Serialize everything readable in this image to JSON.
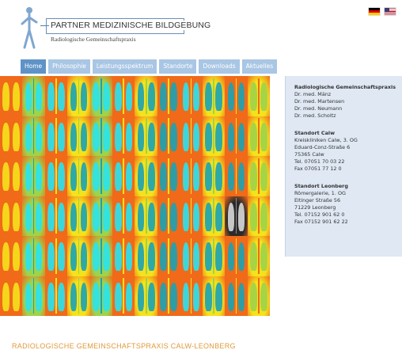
{
  "logo": {
    "name": "PARTNER MEDIZINISCHE BILDGEBUNG",
    "subtitle": "Radiologische Gemeinschaftspraxis",
    "icon": "person-figure-icon"
  },
  "flags": [
    {
      "name": "flag-de-icon",
      "language": "Deutsch"
    },
    {
      "name": "flag-us-icon",
      "language": "English"
    }
  ],
  "nav": {
    "tabs": [
      {
        "label": "Home",
        "active": true
      },
      {
        "label": "Philosophie",
        "active": false
      },
      {
        "label": "Leistungsspektrum",
        "active": false
      },
      {
        "label": "Standorte",
        "active": false
      },
      {
        "label": "Downloads",
        "active": false
      },
      {
        "label": "Aktuelles",
        "active": false
      }
    ],
    "colors": {
      "active": "#5f93c7",
      "inactive": "#a9c6e4"
    }
  },
  "hero": {
    "icon": "chest-xray-collage-image",
    "palette": {
      "warm": "#f06a1a",
      "yellow": "#f5e21c",
      "green": "#9fd34a",
      "teal": "#1aa3b5",
      "cyan": "#28e3f0",
      "gray": "#8a8a8a"
    }
  },
  "sidebar": {
    "practice": {
      "heading": "Radiologische Gemeinschaftspraxis",
      "doctors": [
        "Dr. med. Mänz",
        "Dr. med. Martensen",
        "Dr. med. Neumann",
        "Dr. med. Scholtz"
      ]
    },
    "calw": {
      "heading": "Standort Calw",
      "lines": [
        "Kreiskliniken Calw, 3. OG",
        "Eduard-Conz-Straße 6",
        "75365 Calw",
        "Tel. 07051 70 03 22",
        "Fax 07051 77 12 0"
      ]
    },
    "leonberg": {
      "heading": "Standort Leonberg",
      "lines": [
        "Römergalerie, 1. OG",
        "Eltinger Straße 56",
        "71229 Leonberg",
        "Tel. 07152 901 62 0",
        "Fax 07152 901 62 22"
      ]
    }
  },
  "footer": {
    "title": "RADIOLOGISCHE GEMEINSCHAFTSPRAXIS CALW-LEONBERG",
    "color": "#e09a3a"
  }
}
